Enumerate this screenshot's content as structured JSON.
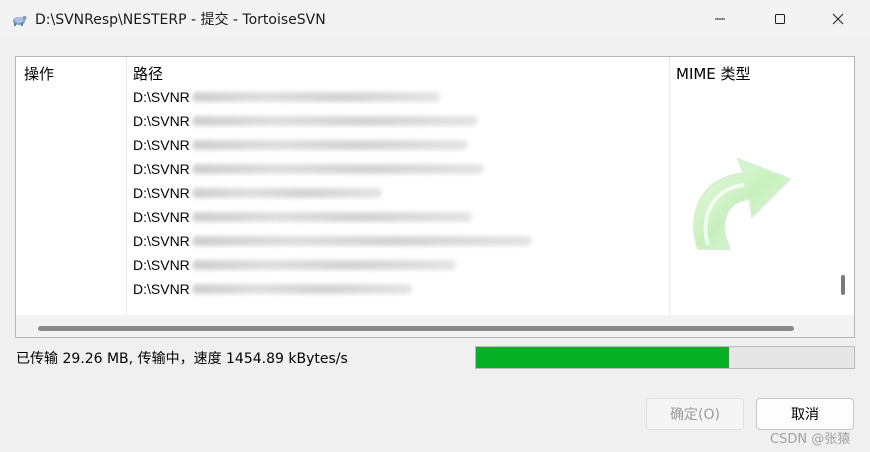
{
  "window": {
    "title": "D:\\SVNResp\\NESTERP - 提交 - TortoiseSVN",
    "app_icon": "tortoise-svn-icon",
    "controls": [
      "minimize",
      "maximize",
      "close"
    ]
  },
  "list": {
    "columns": [
      "操作",
      "路径",
      "MIME 类型"
    ],
    "rows": [
      {
        "path_prefix": "D:\\SVNR"
      },
      {
        "path_prefix": "D:\\SVNR"
      },
      {
        "path_prefix": "D:\\SVNR"
      },
      {
        "path_prefix": "D:\\SVNR"
      },
      {
        "path_prefix": "D:\\SVNR"
      },
      {
        "path_prefix": "D:\\SVNR"
      },
      {
        "path_prefix": "D:\\SVNR"
      },
      {
        "path_prefix": "D:\\SVNR"
      },
      {
        "path_prefix": "D:\\SVNR"
      }
    ]
  },
  "status": {
    "text": "已传输 29.26 MB, 传输中，速度 1454.89 kBytes/s",
    "progress_fraction": 0.67,
    "progress_color": "#06b025"
  },
  "buttons": {
    "ok": "确定(O)",
    "cancel": "取消"
  },
  "watermark": "CSDN @张猿"
}
